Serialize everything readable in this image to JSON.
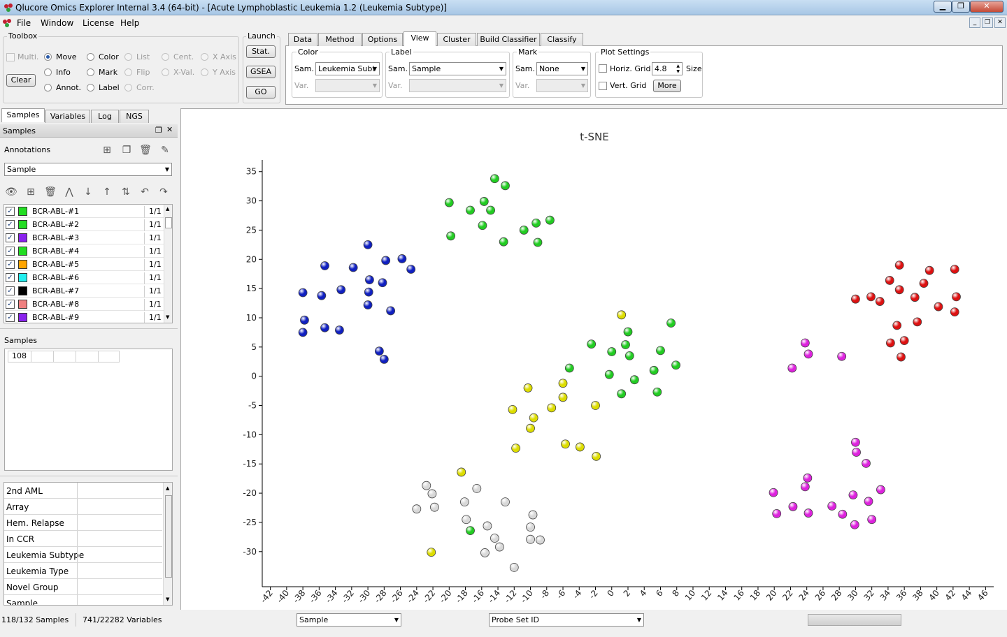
{
  "window": {
    "title": "Qlucore Omics Explorer Internal 3.4 (64-bit) - [Acute Lymphoblastic Leukemia 1.2 (Leukemia Subtype)]",
    "minimize_glyph": "▁",
    "maximize_glyph": "❐",
    "close_glyph": "✕"
  },
  "menu": [
    "File",
    "Window",
    "License",
    "Help"
  ],
  "mdi_glyphs": [
    "_",
    "❐",
    "✕"
  ],
  "toolbox": {
    "title": "Toolbox",
    "multi": "Multi.",
    "clear": "Clear",
    "modes": [
      {
        "label": "Move",
        "selected": true,
        "enabled": true
      },
      {
        "label": "Info",
        "selected": false,
        "enabled": true
      },
      {
        "label": "Annot.",
        "selected": false,
        "enabled": true
      },
      {
        "label": "Color",
        "selected": false,
        "enabled": true
      },
      {
        "label": "Mark",
        "selected": false,
        "enabled": true
      },
      {
        "label": "Label",
        "selected": false,
        "enabled": true
      },
      {
        "label": "List",
        "selected": false,
        "enabled": false
      },
      {
        "label": "Flip",
        "selected": false,
        "enabled": false
      },
      {
        "label": "Corr.",
        "selected": false,
        "enabled": false
      },
      {
        "label": "Cent.",
        "selected": false,
        "enabled": false
      },
      {
        "label": "X-Val.",
        "selected": false,
        "enabled": false
      },
      {
        "label": "X Axis",
        "selected": false,
        "enabled": false
      },
      {
        "label": "Y Axis",
        "selected": false,
        "enabled": false
      }
    ]
  },
  "launch": {
    "title": "Launch",
    "stat": "Stat.",
    "gsea": "GSEA",
    "go": "GO"
  },
  "tabs": [
    "Data",
    "Method",
    "Options",
    "View",
    "Cluster",
    "Build Classifier",
    "Classify"
  ],
  "active_tab": "View",
  "view": {
    "color": {
      "title": "Color",
      "sam_label": "Sam.",
      "sam_value": "Leukemia Subt",
      "var_label": "Var.",
      "var_value": ""
    },
    "label": {
      "title": "Label",
      "sam_label": "Sam.",
      "sam_value": "Sample",
      "var_label": "Var.",
      "var_value": ""
    },
    "mark": {
      "title": "Mark",
      "sam_label": "Sam.",
      "sam_value": "None",
      "var_label": "Var.",
      "var_value": ""
    },
    "plot_settings": {
      "title": "Plot Settings",
      "horiz_grid": "Horiz. Grid",
      "vert_grid": "Vert. Grid",
      "size_value": "4.8",
      "size_label": "Size",
      "more": "More"
    }
  },
  "left_tabs": [
    "Samples",
    "Variables",
    "Log",
    "NGS"
  ],
  "samples_panel": {
    "header": "Samples",
    "annotations_label": "Annotations",
    "annotation_select": "Sample",
    "rows": [
      {
        "name": "BCR-ABL-#1",
        "count": "1/1",
        "color": "#22dd22"
      },
      {
        "name": "BCR-ABL-#2",
        "count": "1/1",
        "color": "#22dd22"
      },
      {
        "name": "BCR-ABL-#3",
        "count": "1/1",
        "color": "#8a22ee"
      },
      {
        "name": "BCR-ABL-#4",
        "count": "1/1",
        "color": "#22dd22"
      },
      {
        "name": "BCR-ABL-#5",
        "count": "1/1",
        "color": "#ffa500"
      },
      {
        "name": "BCR-ABL-#6",
        "count": "1/1",
        "color": "#22eeee"
      },
      {
        "name": "BCR-ABL-#7",
        "count": "1/1",
        "color": "#000000"
      },
      {
        "name": "BCR-ABL-#8",
        "count": "1/1",
        "color": "#f08080"
      },
      {
        "name": "BCR-ABL-#9",
        "count": "1/1",
        "color": "#8a22ee"
      }
    ],
    "check_glyph": "✓",
    "samples_label": "Samples",
    "samples_count": "108",
    "annotation_list": [
      "2nd AML",
      "Array",
      "Hem. Relapse",
      "In CCR",
      "Leukemia Subtype",
      "Leukemia Type",
      "Novel Group",
      "Sample"
    ]
  },
  "status": {
    "samples": "118/132 Samples",
    "variables": "741/22282 Variables",
    "sample_select": "Sample",
    "probe_select": "Probe Set ID"
  },
  "icons": {
    "toolbar1": [
      "add-annotation-icon",
      "copy-icon",
      "trash-icon",
      "brush-icon"
    ],
    "toolbar2": [
      "eye-icon",
      "add-icon",
      "trash-icon",
      "hierarchy-icon",
      "arrow-down-icon",
      "arrow-up-icon",
      "sort-az-icon",
      "undo-icon",
      "redo-icon"
    ]
  },
  "chart_data": {
    "type": "scatter",
    "title": "t-SNE",
    "xlim": [
      -43,
      47
    ],
    "ylim": [
      -36,
      37
    ],
    "xticks": [
      -42,
      -40,
      -38,
      -36,
      -34,
      -32,
      -30,
      -28,
      -26,
      -24,
      -22,
      -20,
      -18,
      -16,
      -14,
      -12,
      -10,
      -8,
      -6,
      -4,
      -2,
      0,
      2,
      4,
      6,
      8,
      10,
      12,
      14,
      16,
      18,
      20,
      22,
      24,
      26,
      28,
      30,
      32,
      34,
      36,
      38,
      40,
      42,
      44,
      46
    ],
    "yticks": [
      35,
      30,
      25,
      20,
      15,
      10,
      5,
      0,
      -5,
      -10,
      -15,
      -20,
      -25,
      -30
    ],
    "grid": false,
    "groups": [
      {
        "color": "#1020c0",
        "points": [
          [
            -38,
            14.3
          ],
          [
            -37.8,
            9.6
          ],
          [
            -38,
            7.5
          ],
          [
            -35.7,
            13.8
          ],
          [
            -35.3,
            18.9
          ],
          [
            -35.3,
            8.3
          ],
          [
            -33.3,
            14.8
          ],
          [
            -33.5,
            7.9
          ],
          [
            -31.8,
            18.6
          ],
          [
            -30,
            22.5
          ],
          [
            -29.8,
            16.5
          ],
          [
            -29.9,
            14.4
          ],
          [
            -30,
            12.2
          ],
          [
            -28.2,
            16
          ],
          [
            -27.8,
            19.8
          ],
          [
            -27.2,
            11.2
          ],
          [
            -28.6,
            4.3
          ],
          [
            -28,
            2.9
          ],
          [
            -25.8,
            20.1
          ],
          [
            -24.7,
            18.3
          ]
        ]
      },
      {
        "color": "#22cc22",
        "points": [
          [
            -20,
            29.7
          ],
          [
            -19.8,
            24
          ],
          [
            -17.4,
            28.4
          ],
          [
            -15.7,
            29.9
          ],
          [
            -15.9,
            25.8
          ],
          [
            -14.9,
            28.4
          ],
          [
            -14.4,
            33.8
          ],
          [
            -13.1,
            32.6
          ],
          [
            -13.3,
            23
          ],
          [
            -10.8,
            25
          ],
          [
            -9.3,
            26.2
          ],
          [
            -9.1,
            22.9
          ],
          [
            -7.6,
            26.7
          ],
          [
            -17.4,
            -26.4
          ]
        ]
      },
      {
        "color": "#22cc22",
        "points": [
          [
            -5.2,
            1.4
          ],
          [
            -2.5,
            5.5
          ],
          [
            -0.3,
            0.3
          ],
          [
            0,
            4.2
          ],
          [
            1.7,
            5.4
          ],
          [
            2,
            7.6
          ],
          [
            2.2,
            3.5
          ],
          [
            2.8,
            -0.6
          ],
          [
            1.2,
            -3
          ],
          [
            5.2,
            1
          ],
          [
            6,
            4.4
          ],
          [
            5.6,
            -2.7
          ],
          [
            7.3,
            9.1
          ],
          [
            7.9,
            1.9
          ]
        ]
      },
      {
        "color": "#dddd00",
        "points": [
          [
            1.2,
            10.5
          ],
          [
            -10.3,
            -2
          ],
          [
            -6,
            -1.2
          ],
          [
            -6,
            -3.6
          ],
          [
            -7.4,
            -5.4
          ],
          [
            -9.6,
            -7.1
          ],
          [
            -10,
            -8.9
          ],
          [
            -12.2,
            -5.7
          ],
          [
            -11.8,
            -12.3
          ],
          [
            -2,
            -5
          ],
          [
            -5.7,
            -11.6
          ],
          [
            -3.9,
            -12.1
          ],
          [
            -1.9,
            -13.7
          ],
          [
            -18.5,
            -16.4
          ],
          [
            -22.2,
            -30.1
          ]
        ]
      },
      {
        "color": "#d8d8d8",
        "points": [
          [
            -24,
            -22.7
          ],
          [
            -22.8,
            -18.7
          ],
          [
            -22.1,
            -20.1
          ],
          [
            -21.8,
            -22.4
          ],
          [
            -18.1,
            -21.5
          ],
          [
            -17.9,
            -24.5
          ],
          [
            -16.6,
            -19.2
          ],
          [
            -15.3,
            -25.6
          ],
          [
            -15.6,
            -30.2
          ],
          [
            -14.4,
            -27.7
          ],
          [
            -13.1,
            -21.5
          ],
          [
            -13.8,
            -29.2
          ],
          [
            -12,
            -32.7
          ],
          [
            -10,
            -25.8
          ],
          [
            -9.7,
            -23.7
          ],
          [
            -10,
            -27.9
          ],
          [
            -8.8,
            -28
          ]
        ]
      },
      {
        "color": "#dd22dd",
        "points": [
          [
            22.2,
            1.4
          ],
          [
            23.8,
            5.7
          ],
          [
            24.2,
            3.8
          ],
          [
            28.3,
            3.4
          ],
          [
            30,
            -11.3
          ],
          [
            30.1,
            -13
          ],
          [
            31.3,
            -14.9
          ],
          [
            19.9,
            -19.9
          ],
          [
            20.3,
            -23.5
          ],
          [
            22.3,
            -22.3
          ],
          [
            23.8,
            -18.9
          ],
          [
            24.1,
            -17.4
          ],
          [
            24.2,
            -23.4
          ],
          [
            27.1,
            -22.2
          ],
          [
            28.4,
            -23.6
          ],
          [
            29.7,
            -20.3
          ],
          [
            29.9,
            -25.4
          ],
          [
            31.6,
            -21.4
          ],
          [
            32,
            -24.5
          ],
          [
            33.1,
            -19.4
          ]
        ]
      },
      {
        "color": "#dd1111",
        "points": [
          [
            30,
            13.2
          ],
          [
            31.9,
            13.6
          ],
          [
            33,
            12.8
          ],
          [
            34.2,
            16.4
          ],
          [
            34.3,
            5.7
          ],
          [
            35.1,
            8.7
          ],
          [
            35.4,
            19
          ],
          [
            35.4,
            14.8
          ],
          [
            35.6,
            3.3
          ],
          [
            36,
            6.1
          ],
          [
            37.3,
            13.5
          ],
          [
            37.6,
            9.3
          ],
          [
            38.4,
            15.9
          ],
          [
            39.1,
            18.1
          ],
          [
            40.2,
            11.9
          ],
          [
            42.2,
            18.3
          ],
          [
            42.2,
            11
          ],
          [
            42.4,
            13.6
          ]
        ]
      }
    ]
  }
}
